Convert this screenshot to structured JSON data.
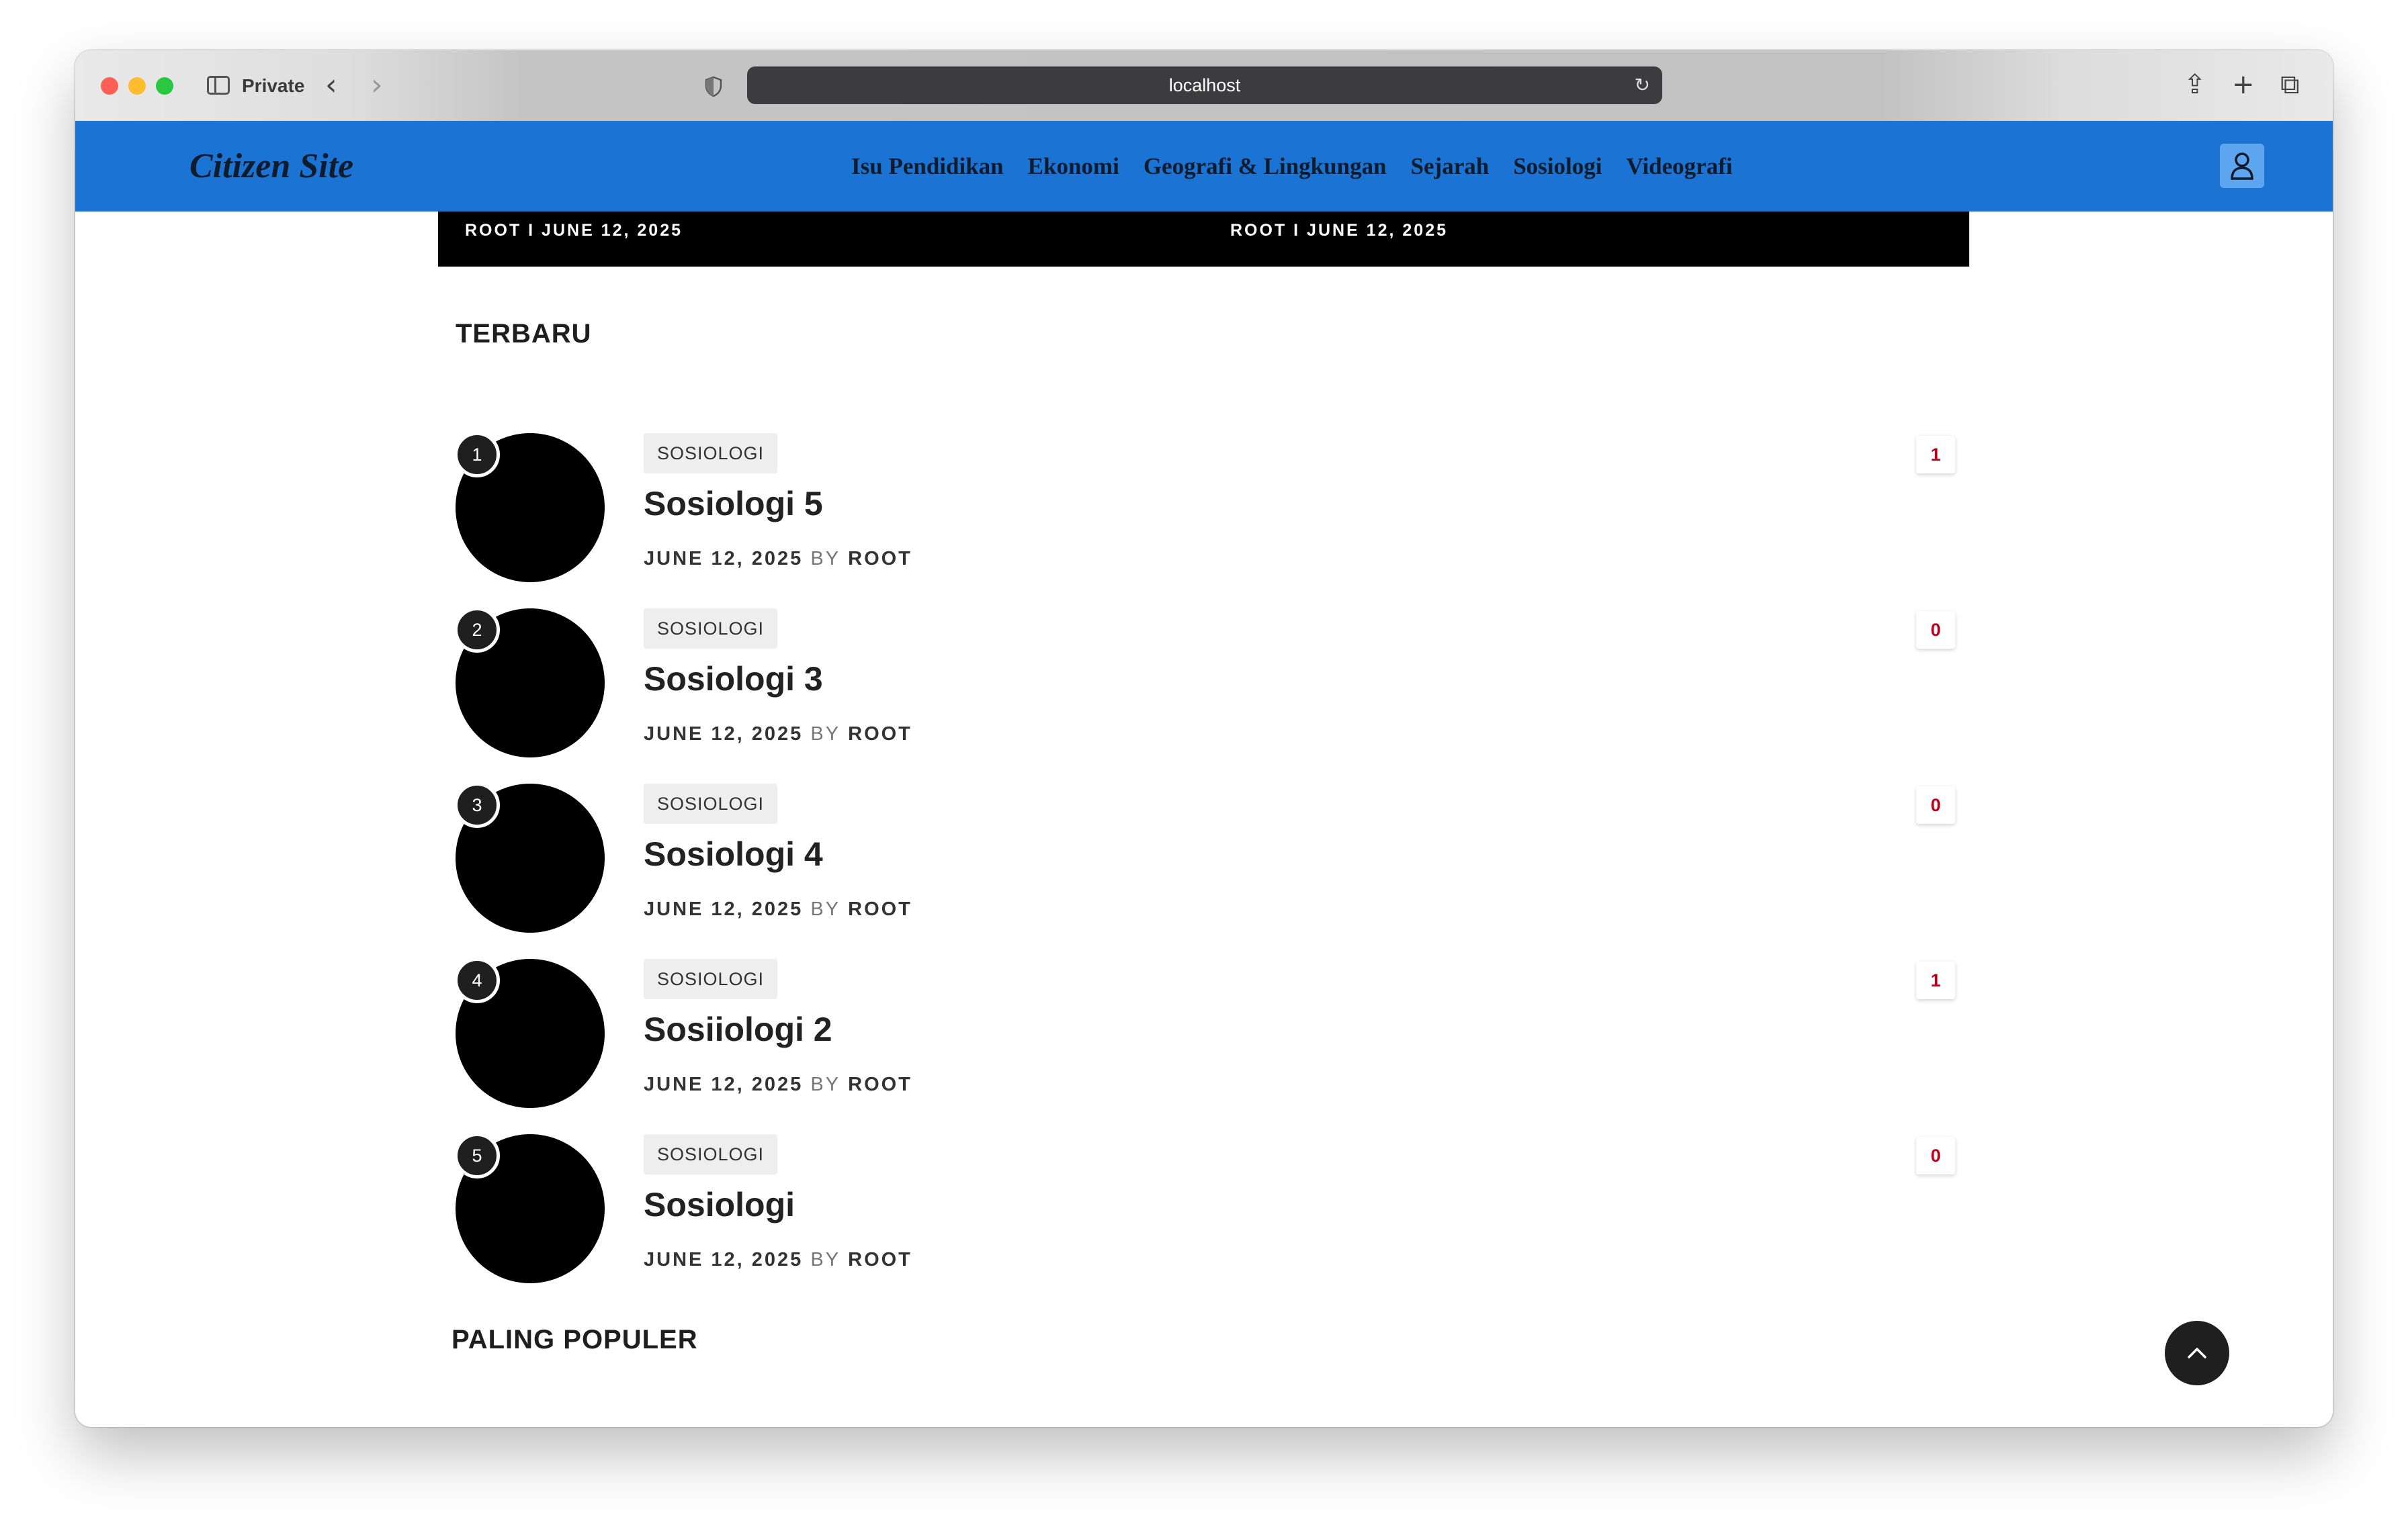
{
  "browser": {
    "private_label": "Private",
    "url": "localhost"
  },
  "site": {
    "logo": "Citizen Site",
    "nav": [
      "Isu Pendidikan",
      "Ekonomi",
      "Geografi & Lingkungan",
      "Sejarah",
      "Sosiologi",
      "Videografi"
    ]
  },
  "hero": {
    "left_meta": "ROOT I JUNE 12, 2025",
    "right_meta": "ROOT I JUNE 12, 2025"
  },
  "sections": {
    "terbaru": "TERBARU",
    "populer": "PALING POPULER"
  },
  "articles": [
    {
      "rank": "1",
      "category": "SOSIOLOGI",
      "title": "Sosiologi 5",
      "date": "JUNE 12, 2025",
      "by": "BY",
      "author": "ROOT",
      "comments": "1"
    },
    {
      "rank": "2",
      "category": "SOSIOLOGI",
      "title": "Sosiologi 3",
      "date": "JUNE 12, 2025",
      "by": "BY",
      "author": "ROOT",
      "comments": "0"
    },
    {
      "rank": "3",
      "category": "SOSIOLOGI",
      "title": "Sosiologi 4",
      "date": "JUNE 12, 2025",
      "by": "BY",
      "author": "ROOT",
      "comments": "0"
    },
    {
      "rank": "4",
      "category": "SOSIOLOGI",
      "title": "Sosiiologi 2",
      "date": "JUNE 12, 2025",
      "by": "BY",
      "author": "ROOT",
      "comments": "1"
    },
    {
      "rank": "5",
      "category": "SOSIOLOGI",
      "title": "Sosiologi",
      "date": "JUNE 12, 2025",
      "by": "BY",
      "author": "ROOT",
      "comments": "0"
    }
  ],
  "colors": {
    "header_bg": "#1b74d4",
    "comment_count": "#c0001a"
  },
  "icons": [
    "sidebar-icon",
    "back-icon",
    "forward-icon",
    "shield-icon",
    "reload-icon",
    "share-icon",
    "plus-icon",
    "tabs-icon",
    "user-icon",
    "chevron-up-icon"
  ]
}
